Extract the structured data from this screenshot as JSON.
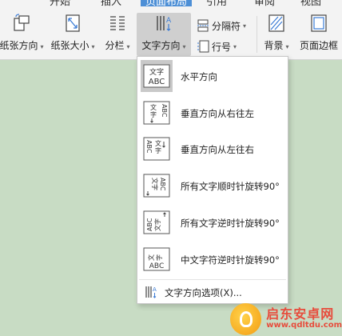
{
  "ribbon": {
    "tabs": [
      {
        "label": "开始",
        "active": false
      },
      {
        "label": "插入",
        "active": false
      },
      {
        "label": "页面布局",
        "active": true
      },
      {
        "label": "引用",
        "active": false
      },
      {
        "label": "审阅",
        "active": false
      },
      {
        "label": "视图",
        "active": false
      }
    ],
    "paper_orientation_label": "纸张方向",
    "paper_size_label": "纸张大小",
    "columns_label": "分栏",
    "text_direction_label": "文字方向",
    "separator_label": "分隔符",
    "line_number_label": "行号",
    "background_label": "背景",
    "page_border_label": "页面边框"
  },
  "dropdown": {
    "items": [
      {
        "label": "水平方向",
        "icon": "horizontal-text-icon",
        "selected": true,
        "top_text": "文字",
        "bottom_text": "ABC"
      },
      {
        "label": "垂直方向从右往左",
        "icon": "vertical-rtl-icon",
        "selected": false,
        "top_text": "文字",
        "bottom_text": "ABC"
      },
      {
        "label": "垂直方向从左往右",
        "icon": "vertical-ltr-icon",
        "selected": false,
        "top_text": "文字",
        "bottom_text": "ABC"
      },
      {
        "label": "所有文字顺时针旋转90°",
        "icon": "rotate-cw-icon",
        "selected": false,
        "top_text": "文字",
        "bottom_text": "ABC"
      },
      {
        "label": "所有文字逆时针旋转90°",
        "icon": "rotate-ccw-icon",
        "selected": false,
        "top_text": "文字",
        "bottom_text": "ABC"
      },
      {
        "label": "中文字符逆时针旋转90°",
        "icon": "cjk-rotate-ccw-icon",
        "selected": false,
        "top_text": "文字",
        "bottom_text": "ABC"
      }
    ],
    "options_label": "文字方向选项(X)..."
  },
  "watermark": {
    "title": "启东安卓网",
    "url": "www.qdltdu.com"
  },
  "colors": {
    "document_background": "#c8dcc4",
    "active_tab": "#4d8fd6",
    "watermark_red": "#e74c3c"
  }
}
